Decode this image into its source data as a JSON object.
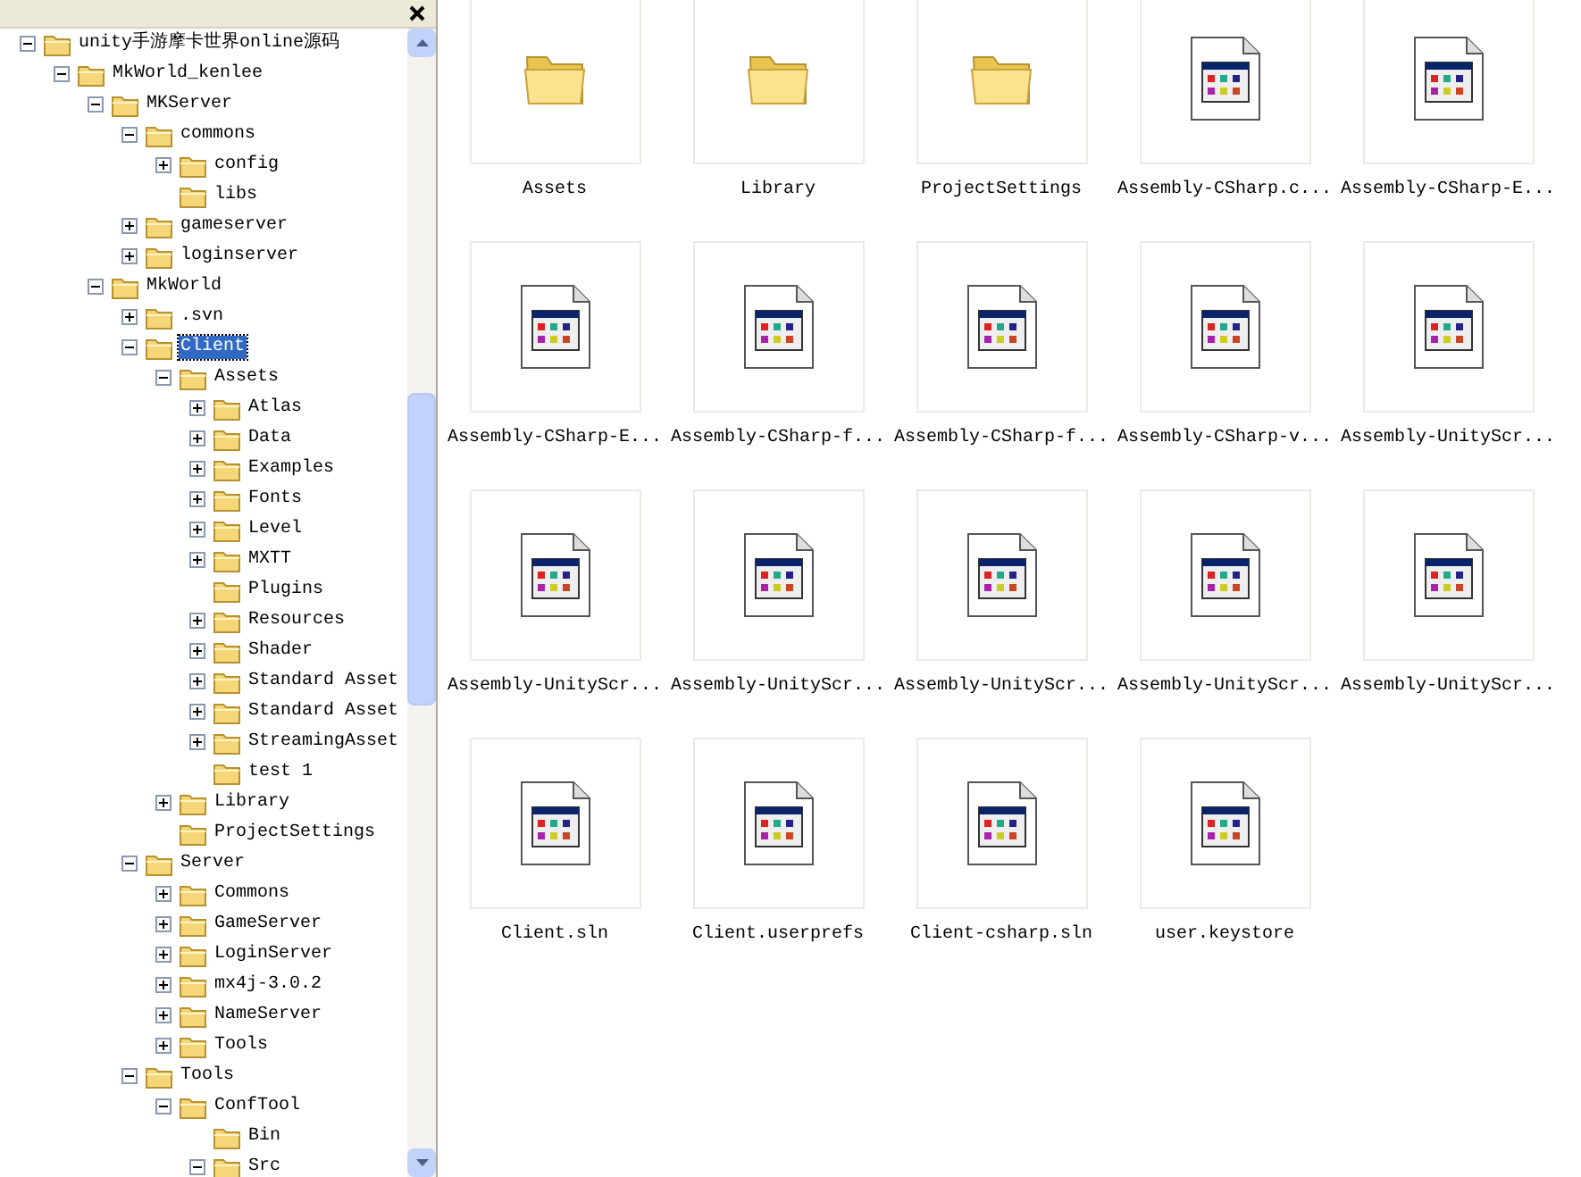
{
  "folder_tree": [
    {
      "label": "unity手游摩卡世界online源码",
      "expanded": true,
      "selected": false,
      "children": [
        {
          "label": "MkWorld_kenlee",
          "expanded": true,
          "selected": false,
          "children": [
            {
              "label": "MKServer",
              "expanded": true,
              "selected": false,
              "children": [
                {
                  "label": "commons",
                  "expanded": true,
                  "selected": false,
                  "children": [
                    {
                      "label": "config",
                      "expanded": false,
                      "selected": false
                    },
                    {
                      "label": "libs",
                      "selected": false
                    }
                  ]
                },
                {
                  "label": "gameserver",
                  "expanded": false,
                  "selected": false
                },
                {
                  "label": "loginserver",
                  "expanded": false,
                  "selected": false
                }
              ]
            },
            {
              "label": "MkWorld",
              "expanded": true,
              "selected": false,
              "children": [
                {
                  "label": ".svn",
                  "expanded": false,
                  "selected": false
                },
                {
                  "label": "Client",
                  "expanded": true,
                  "selected": true,
                  "children": [
                    {
                      "label": "Assets",
                      "expanded": true,
                      "selected": false,
                      "children": [
                        {
                          "label": "Atlas",
                          "expanded": false,
                          "selected": false
                        },
                        {
                          "label": "Data",
                          "expanded": false,
                          "selected": false
                        },
                        {
                          "label": "Examples",
                          "expanded": false,
                          "selected": false
                        },
                        {
                          "label": "Fonts",
                          "expanded": false,
                          "selected": false
                        },
                        {
                          "label": "Level",
                          "expanded": false,
                          "selected": false
                        },
                        {
                          "label": "MXTT",
                          "expanded": false,
                          "selected": false
                        },
                        {
                          "label": "Plugins",
                          "selected": false
                        },
                        {
                          "label": "Resources",
                          "expanded": false,
                          "selected": false
                        },
                        {
                          "label": "Shader",
                          "expanded": false,
                          "selected": false
                        },
                        {
                          "label": "Standard Asset",
                          "expanded": false,
                          "selected": false
                        },
                        {
                          "label": "Standard Asset",
                          "expanded": false,
                          "selected": false
                        },
                        {
                          "label": "StreamingAsset",
                          "expanded": false,
                          "selected": false
                        },
                        {
                          "label": "test 1",
                          "selected": false
                        }
                      ]
                    },
                    {
                      "label": "Library",
                      "expanded": false,
                      "selected": false
                    },
                    {
                      "label": "ProjectSettings",
                      "selected": false
                    }
                  ]
                },
                {
                  "label": "Server",
                  "expanded": true,
                  "selected": false,
                  "children": [
                    {
                      "label": "Commons",
                      "expanded": false,
                      "selected": false
                    },
                    {
                      "label": "GameServer",
                      "expanded": false,
                      "selected": false
                    },
                    {
                      "label": "LoginServer",
                      "expanded": false,
                      "selected": false
                    },
                    {
                      "label": "mx4j-3.0.2",
                      "expanded": false,
                      "selected": false
                    },
                    {
                      "label": "NameServer",
                      "expanded": false,
                      "selected": false
                    },
                    {
                      "label": "Tools",
                      "expanded": false,
                      "selected": false
                    }
                  ]
                },
                {
                  "label": "Tools",
                  "expanded": true,
                  "selected": false,
                  "children": [
                    {
                      "label": "ConfTool",
                      "expanded": true,
                      "selected": false,
                      "children": [
                        {
                          "label": "Bin",
                          "selected": false
                        },
                        {
                          "label": "Src",
                          "expanded": true,
                          "selected": false
                        }
                      ]
                    }
                  ]
                }
              ]
            }
          ]
        }
      ]
    }
  ],
  "files": [
    {
      "name": "Assets",
      "kind": "folder"
    },
    {
      "name": "Library",
      "kind": "folder"
    },
    {
      "name": "ProjectSettings",
      "kind": "folder"
    },
    {
      "name": "Assembly-CSharp.c...",
      "kind": "file"
    },
    {
      "name": "Assembly-CSharp-E...",
      "kind": "file"
    },
    {
      "name": "Assembly-CSharp-E...",
      "kind": "file"
    },
    {
      "name": "Assembly-CSharp-f...",
      "kind": "file"
    },
    {
      "name": "Assembly-CSharp-f...",
      "kind": "file"
    },
    {
      "name": "Assembly-CSharp-v...",
      "kind": "file"
    },
    {
      "name": "Assembly-UnityScr...",
      "kind": "file"
    },
    {
      "name": "Assembly-UnityScr...",
      "kind": "file"
    },
    {
      "name": "Assembly-UnityScr...",
      "kind": "file"
    },
    {
      "name": "Assembly-UnityScr...",
      "kind": "file"
    },
    {
      "name": "Assembly-UnityScr...",
      "kind": "file"
    },
    {
      "name": "Assembly-UnityScr...",
      "kind": "file"
    },
    {
      "name": "Client.sln",
      "kind": "file"
    },
    {
      "name": "Client.userprefs",
      "kind": "file"
    },
    {
      "name": "Client-csharp.sln",
      "kind": "file"
    },
    {
      "name": "user.keystore",
      "kind": "file"
    }
  ]
}
